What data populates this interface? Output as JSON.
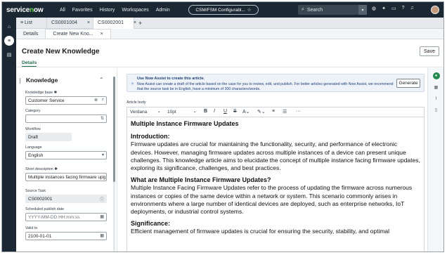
{
  "nav": {
    "logo_text": "servicenow",
    "links": [
      "All",
      "Favorites",
      "History",
      "Workspaces",
      "Admin"
    ],
    "app_scope": "CSM/FSM Configurabl...",
    "search_placeholder": "Search",
    "icons": [
      "globe-icon",
      "star-icon",
      "chat-icon",
      "help-icon",
      "bell-icon"
    ]
  },
  "tabs": {
    "list": "List",
    "tab1": "CS0001004",
    "tab2": "CS0002001"
  },
  "subtabs": {
    "details": "Details",
    "create": "Create New Kno..."
  },
  "header": {
    "title": "Create New Knowledge",
    "save": "Save",
    "details_tab": "Details"
  },
  "form": {
    "section": "Knowledge",
    "kb_label": "Knowledge base",
    "kb_value": "Customer Service",
    "category_label": "Category",
    "category_value": "",
    "workflow_label": "Workflow",
    "workflow_value": "Draft",
    "language_label": "Language",
    "language_value": "English",
    "short_desc_label": "Short description",
    "short_desc_value": "Multiple instances facing firmware upg",
    "source_task_label": "Source Task",
    "source_task_value": "CS0002001",
    "publish_label": "Scheduled publish date",
    "publish_placeholder": "YYYY-MM-DD HH:mm:ss",
    "valid_label": "Valid to",
    "valid_value": "2100-01-01"
  },
  "assist": {
    "heading": "Use Now Assist to create this article.",
    "body": "Now Assist can create a draft of the article based on the case for you to review, edit, and publish. For better articles generated with Now Assist, we recommend that the source task be in English, have a minimum of 300 characters/words.",
    "button": "Generate"
  },
  "editor": {
    "label": "Article body",
    "font": "Verdana",
    "size": "10pt",
    "title": "Multiple Instance Firmware Updates",
    "sections": [
      {
        "heading": "Introduction:",
        "text": "Firmware updates are crucial for maintaining the functionality, security, and performance of electronic devices. However, managing firmware updates across multiple instances of a device can present unique challenges. This knowledge article aims to elucidate the concept of multiple instance facing firmware updates, exploring its significance, challenges, and best practices."
      },
      {
        "heading": "What are Multiple Instance Firmware Updates?",
        "text": "Multiple Instance Facing Firmware Updates refer to the process of updating the firmware across numerous instances or copies of the same device within a network or system. This scenario commonly arises in environments where a large number of identical devices are deployed, such as enterprise networks, IoT deployments, or industrial control systems."
      },
      {
        "heading": "Significance:",
        "text": "Efficient management of firmware updates is crucial for ensuring the security, stability, and optimal"
      }
    ]
  }
}
